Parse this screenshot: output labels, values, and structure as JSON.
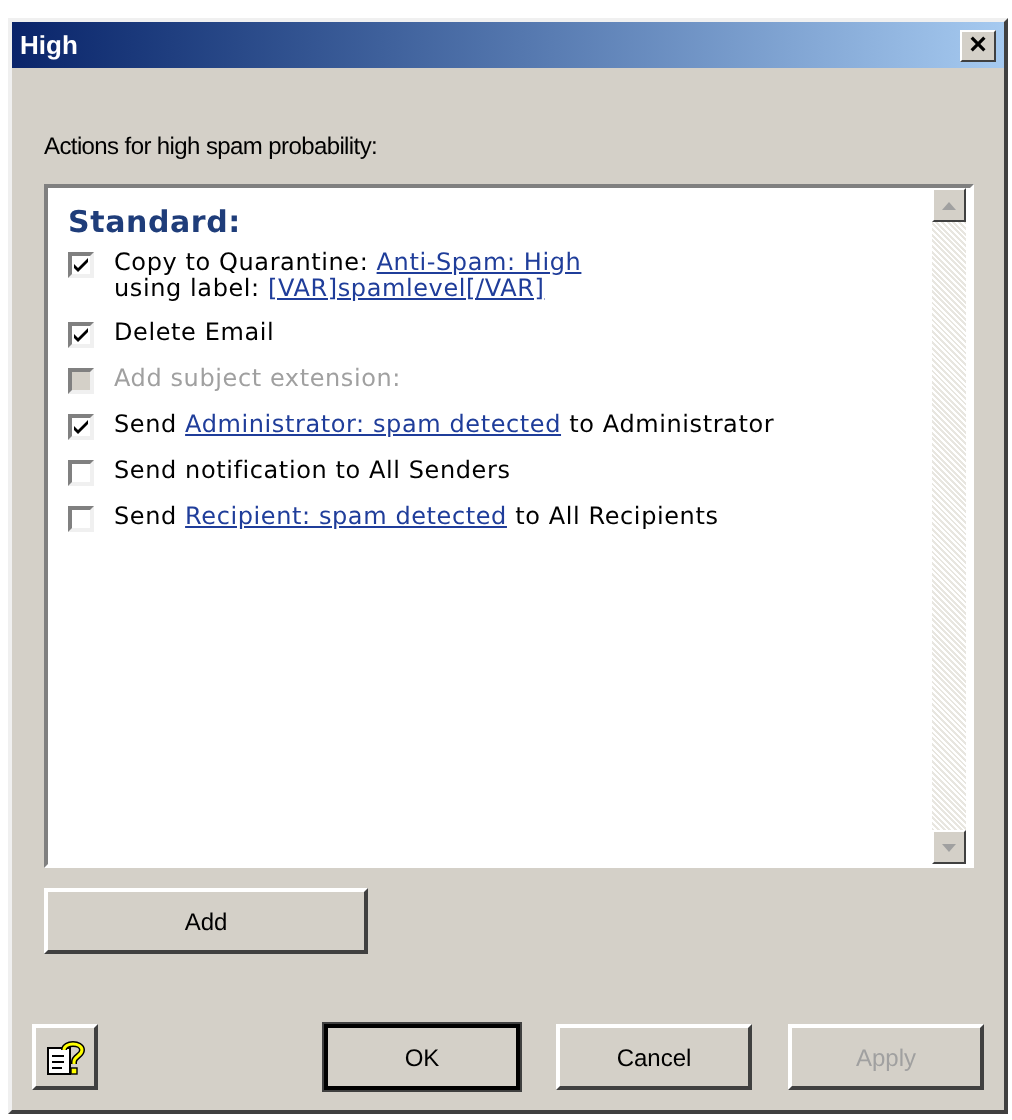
{
  "window": {
    "title": "High",
    "close": "×"
  },
  "caption": "Actions for high spam probability:",
  "list": {
    "heading": "Standard:",
    "items": [
      {
        "checked": true,
        "disabled": false,
        "lines": [
          [
            {
              "kind": "text",
              "text": "Copy to Quarantine: "
            },
            {
              "kind": "link",
              "text": "Anti-Spam: High"
            }
          ],
          [
            {
              "kind": "text",
              "text": "using label: "
            },
            {
              "kind": "link",
              "text": "[VAR]spamlevel[/VAR]"
            }
          ]
        ]
      },
      {
        "checked": true,
        "disabled": false,
        "lines": [
          [
            {
              "kind": "text",
              "text": "Delete Email"
            }
          ]
        ]
      },
      {
        "checked": false,
        "disabled": true,
        "lines": [
          [
            {
              "kind": "text",
              "text": "Add subject extension:"
            }
          ]
        ]
      },
      {
        "checked": true,
        "disabled": false,
        "lines": [
          [
            {
              "kind": "text",
              "text": "Send "
            },
            {
              "kind": "link",
              "text": "Administrator: spam detected"
            },
            {
              "kind": "text",
              "text": " to Administrator"
            }
          ]
        ]
      },
      {
        "checked": false,
        "disabled": false,
        "lines": [
          [
            {
              "kind": "text",
              "text": "Send notification to All Senders"
            }
          ]
        ]
      },
      {
        "checked": false,
        "disabled": false,
        "lines": [
          [
            {
              "kind": "text",
              "text": "Send "
            },
            {
              "kind": "link",
              "text": "Recipient: spam detected"
            },
            {
              "kind": "text",
              "text": " to All Recipients"
            }
          ]
        ]
      }
    ]
  },
  "add_button": {
    "label": "Add"
  },
  "buttons": [
    {
      "label": "OK",
      "disabled": false,
      "default": true
    },
    {
      "label": "Cancel",
      "disabled": false,
      "default": false
    },
    {
      "label": "Apply",
      "disabled": true,
      "default": false
    }
  ]
}
